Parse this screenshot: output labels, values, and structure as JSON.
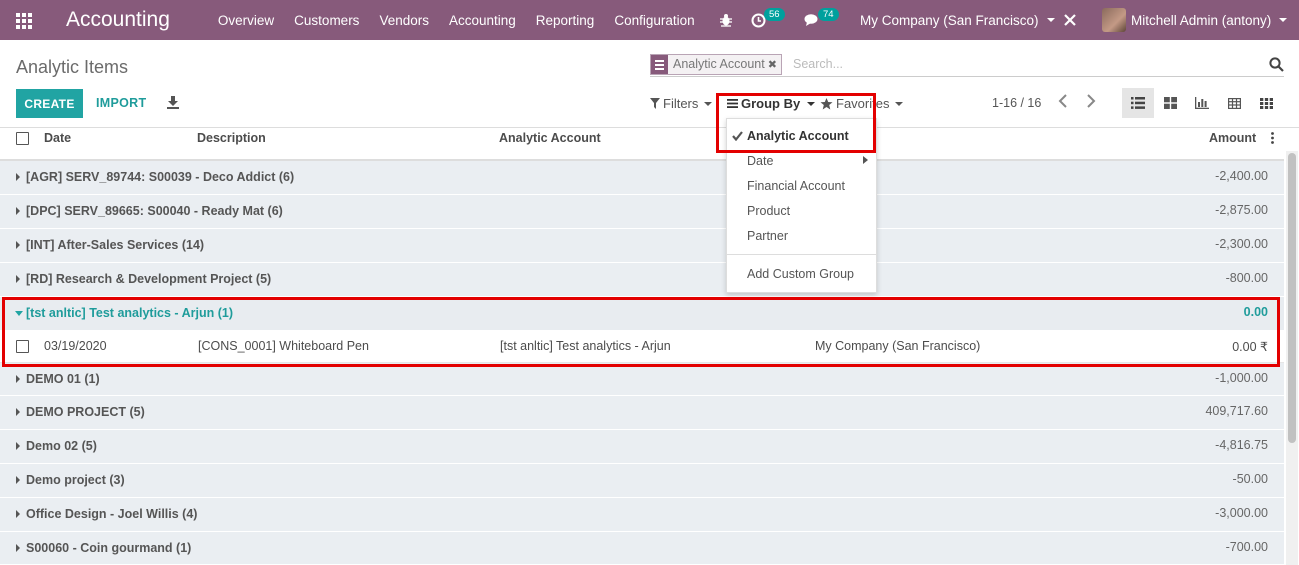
{
  "navbar": {
    "app_title": "Accounting",
    "menu": [
      "Overview",
      "Customers",
      "Vendors",
      "Accounting",
      "Reporting",
      "Configuration"
    ],
    "activity_count": "56",
    "message_count": "74",
    "company": "My Company (San Francisco)",
    "user": "Mitchell Admin (antony)"
  },
  "control_panel": {
    "title": "Analytic Items",
    "create_label": "CREATE",
    "import_label": "IMPORT",
    "search_facet": "Analytic Account",
    "search_placeholder": "Search...",
    "filters_label": "Filters",
    "groupby_label": "Group By",
    "favorites_label": "Favorites",
    "pager": "1-16 / 16"
  },
  "groupby_menu": {
    "items": [
      "Analytic Account",
      "Date",
      "Financial Account",
      "Product",
      "Partner"
    ],
    "custom_label": "Add Custom Group"
  },
  "table": {
    "columns": {
      "date": "Date",
      "description": "Description",
      "analytic_account": "Analytic Account",
      "amount": "Amount"
    },
    "groups": [
      {
        "name": "[AGR] SERV_89744: S00039 - Deco Addict (6)",
        "amount": "-2,400.00"
      },
      {
        "name": "[DPC] SERV_89665: S00040 - Ready Mat (6)",
        "amount": "-2,875.00"
      },
      {
        "name": "[INT] After-Sales Services (14)",
        "amount": "-2,300.00"
      },
      {
        "name": "[RD] Research & Development Project (5)",
        "amount": "-800.00"
      },
      {
        "name": "[tst anltic] Test analytics - Arjun (1)",
        "amount": "0.00"
      },
      {
        "name": "DEMO 01 (1)",
        "amount": "-1,000.00"
      },
      {
        "name": "DEMO PROJECT (5)",
        "amount": "409,717.60"
      },
      {
        "name": "Demo 02 (5)",
        "amount": "-4,816.75"
      },
      {
        "name": "Demo project (3)",
        "amount": "-50.00"
      },
      {
        "name": "Office Design - Joel Willis (4)",
        "amount": "-3,000.00"
      },
      {
        "name": "S00060 - Coin gourmand (1)",
        "amount": "-700.00"
      }
    ],
    "detail_row": {
      "date": "03/19/2020",
      "description": "[CONS_0001] Whiteboard Pen",
      "analytic_account": "[tst anltic] Test analytics - Arjun",
      "company": "My Company (San Francisco)",
      "amount": "0.00 ₹"
    }
  },
  "colors": {
    "brand": "#875a7b",
    "accent": "#21a4a3",
    "highlight": "#e30000"
  }
}
